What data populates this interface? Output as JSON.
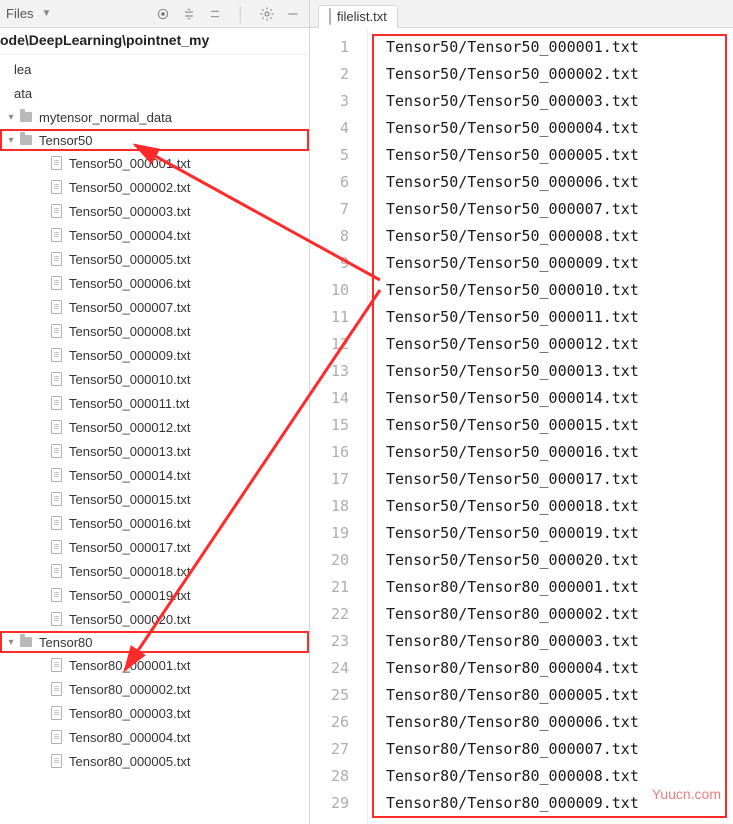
{
  "left": {
    "title": "Files",
    "breadcrumb": "ode\\DeepLearning\\pointnet_my",
    "root_items": [
      "lea",
      "ata"
    ],
    "folder1": "mytensor_normal_data",
    "folder2": "Tensor50",
    "folder3": "Tensor80",
    "tensor50_files": [
      "Tensor50_000001.txt",
      "Tensor50_000002.txt",
      "Tensor50_000003.txt",
      "Tensor50_000004.txt",
      "Tensor50_000005.txt",
      "Tensor50_000006.txt",
      "Tensor50_000007.txt",
      "Tensor50_000008.txt",
      "Tensor50_000009.txt",
      "Tensor50_000010.txt",
      "Tensor50_000011.txt",
      "Tensor50_000012.txt",
      "Tensor50_000013.txt",
      "Tensor50_000014.txt",
      "Tensor50_000015.txt",
      "Tensor50_000016.txt",
      "Tensor50_000017.txt",
      "Tensor50_000018.txt",
      "Tensor50_000019.txt",
      "Tensor50_000020.txt"
    ],
    "tensor80_files": [
      "Tensor80_000001.txt",
      "Tensor80_000002.txt",
      "Tensor80_000003.txt",
      "Tensor80_000004.txt",
      "Tensor80_000005.txt"
    ]
  },
  "tab": {
    "label": "filelist.txt"
  },
  "editor": {
    "lines": [
      "Tensor50/Tensor50_000001.txt",
      "Tensor50/Tensor50_000002.txt",
      "Tensor50/Tensor50_000003.txt",
      "Tensor50/Tensor50_000004.txt",
      "Tensor50/Tensor50_000005.txt",
      "Tensor50/Tensor50_000006.txt",
      "Tensor50/Tensor50_000007.txt",
      "Tensor50/Tensor50_000008.txt",
      "Tensor50/Tensor50_000009.txt",
      "Tensor50/Tensor50_000010.txt",
      "Tensor50/Tensor50_000011.txt",
      "Tensor50/Tensor50_000012.txt",
      "Tensor50/Tensor50_000013.txt",
      "Tensor50/Tensor50_000014.txt",
      "Tensor50/Tensor50_000015.txt",
      "Tensor50/Tensor50_000016.txt",
      "Tensor50/Tensor50_000017.txt",
      "Tensor50/Tensor50_000018.txt",
      "Tensor50/Tensor50_000019.txt",
      "Tensor50/Tensor50_000020.txt",
      "Tensor80/Tensor80_000001.txt",
      "Tensor80/Tensor80_000002.txt",
      "Tensor80/Tensor80_000003.txt",
      "Tensor80/Tensor80_000004.txt",
      "Tensor80/Tensor80_000005.txt",
      "Tensor80/Tensor80_000006.txt",
      "Tensor80/Tensor80_000007.txt",
      "Tensor80/Tensor80_000008.txt",
      "Tensor80/Tensor80_000009.txt"
    ]
  },
  "watermark": "Yuucn.com"
}
